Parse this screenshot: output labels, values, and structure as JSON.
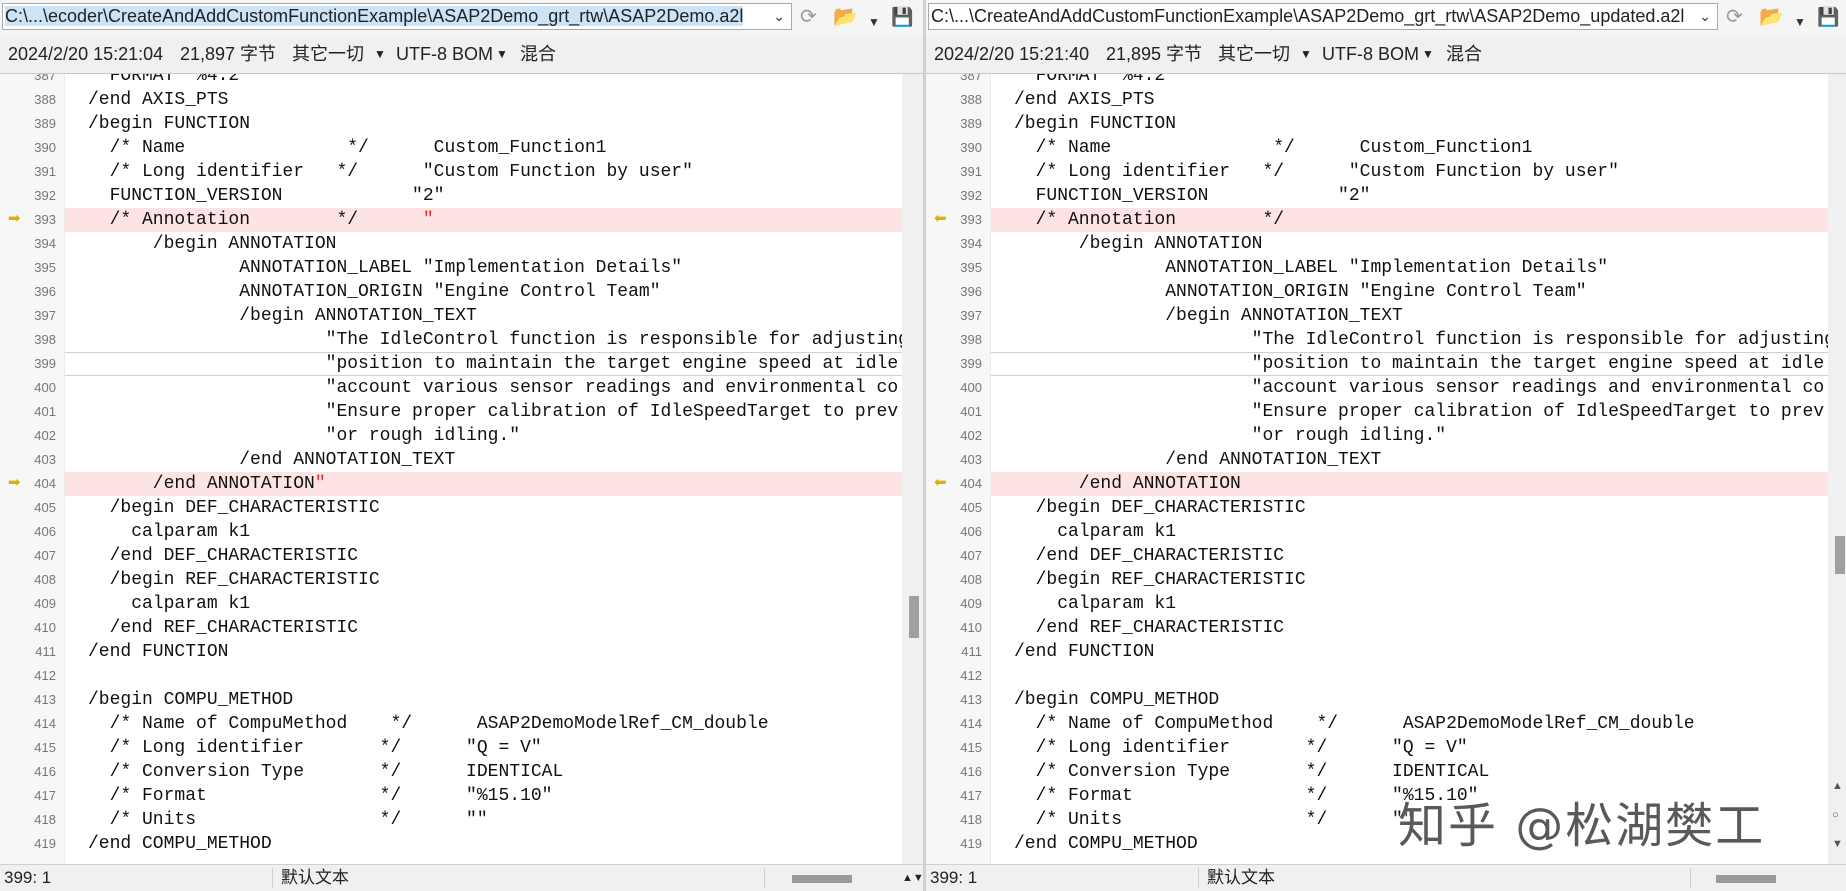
{
  "left": {
    "path": "C:\\...\\ecoder\\CreateAndAddCustomFunctionExample\\ASAP2Demo_grt_rtw\\ASAP2Demo.a2l",
    "timestamp": "2024/2/20 15:21:04",
    "size": "21,897 字节",
    "line_ending": "其它一切",
    "encoding": "UTF-8 BOM",
    "mode": "混合",
    "status_pos": "399: 1",
    "status_lang": "默认文本"
  },
  "right": {
    "path": "C:\\...\\CreateAndAddCustomFunctionExample\\ASAP2Demo_grt_rtw\\ASAP2Demo_updated.a2l",
    "timestamp": "2024/2/20 15:21:40",
    "size": "21,895 字节",
    "line_ending": "其它一切",
    "encoding": "UTF-8 BOM",
    "mode": "混合",
    "status_pos": "399: 1",
    "status_lang": "默认文本"
  },
  "icons": {
    "dropdown": "chevron-down-icon",
    "sync": "sync-icon",
    "open": "folder-open-icon",
    "menu": "small-dropdown-icon",
    "save": "save-icon",
    "diff_marker": "diff-arrow-icon"
  },
  "colors": {
    "diff_bg": "#fde3e3",
    "diff_marker": "#e0b000",
    "extra_text": "#e03030"
  },
  "lines": [
    {
      "n": "387",
      "code": "  FORMAT \"%4.2\""
    },
    {
      "n": "388",
      "code": "/end AXIS_PTS"
    },
    {
      "n": "389",
      "code": "/begin FUNCTION"
    },
    {
      "n": "390",
      "code": "  /* Name               */      Custom_Function1"
    },
    {
      "n": "391",
      "code": "  /* Long identifier   */      \"Custom Function by user\""
    },
    {
      "n": "392",
      "code": "  FUNCTION_VERSION            \"2\""
    },
    {
      "n": "393",
      "code": "  /* Annotation        */      ",
      "extra_left": "\"",
      "diff": true
    },
    {
      "n": "394",
      "code": "      /begin ANNOTATION"
    },
    {
      "n": "395",
      "code": "              ANNOTATION_LABEL \"Implementation Details\""
    },
    {
      "n": "396",
      "code": "              ANNOTATION_ORIGIN \"Engine Control Team\""
    },
    {
      "n": "397",
      "code": "              /begin ANNOTATION_TEXT"
    },
    {
      "n": "398",
      "code": "                      \"The IdleControl function is responsible for adjusting"
    },
    {
      "n": "399",
      "code": "                      \"position to maintain the target engine speed at idle",
      "current": true
    },
    {
      "n": "400",
      "code": "                      \"account various sensor readings and environmental co"
    },
    {
      "n": "401",
      "code": "                      \"Ensure proper calibration of IdleSpeedTarget to prev"
    },
    {
      "n": "402",
      "code": "                      \"or rough idling.\""
    },
    {
      "n": "403",
      "code": "              /end ANNOTATION_TEXT"
    },
    {
      "n": "404",
      "code": "      /end ANNOTATION",
      "extra_left": "\"",
      "diff": true
    },
    {
      "n": "405",
      "code": "  /begin DEF_CHARACTERISTIC"
    },
    {
      "n": "406",
      "code": "    calparam k1"
    },
    {
      "n": "407",
      "code": "  /end DEF_CHARACTERISTIC"
    },
    {
      "n": "408",
      "code": "  /begin REF_CHARACTERISTIC"
    },
    {
      "n": "409",
      "code": "    calparam k1"
    },
    {
      "n": "410",
      "code": "  /end REF_CHARACTERISTIC"
    },
    {
      "n": "411",
      "code": "/end FUNCTION"
    },
    {
      "n": "412",
      "code": ""
    },
    {
      "n": "413",
      "code": "/begin COMPU_METHOD"
    },
    {
      "n": "414",
      "code": "  /* Name of CompuMethod    */      ASAP2DemoModelRef_CM_double"
    },
    {
      "n": "415",
      "code": "  /* Long identifier       */      \"Q = V\""
    },
    {
      "n": "416",
      "code": "  /* Conversion Type       */      IDENTICAL"
    },
    {
      "n": "417",
      "code": "  /* Format                */      \"%15.10\""
    },
    {
      "n": "418",
      "code": "  /* Units                 */      \"\""
    },
    {
      "n": "419",
      "code": "/end COMPU_METHOD"
    }
  ],
  "watermark": "知乎 @松湖樊工"
}
